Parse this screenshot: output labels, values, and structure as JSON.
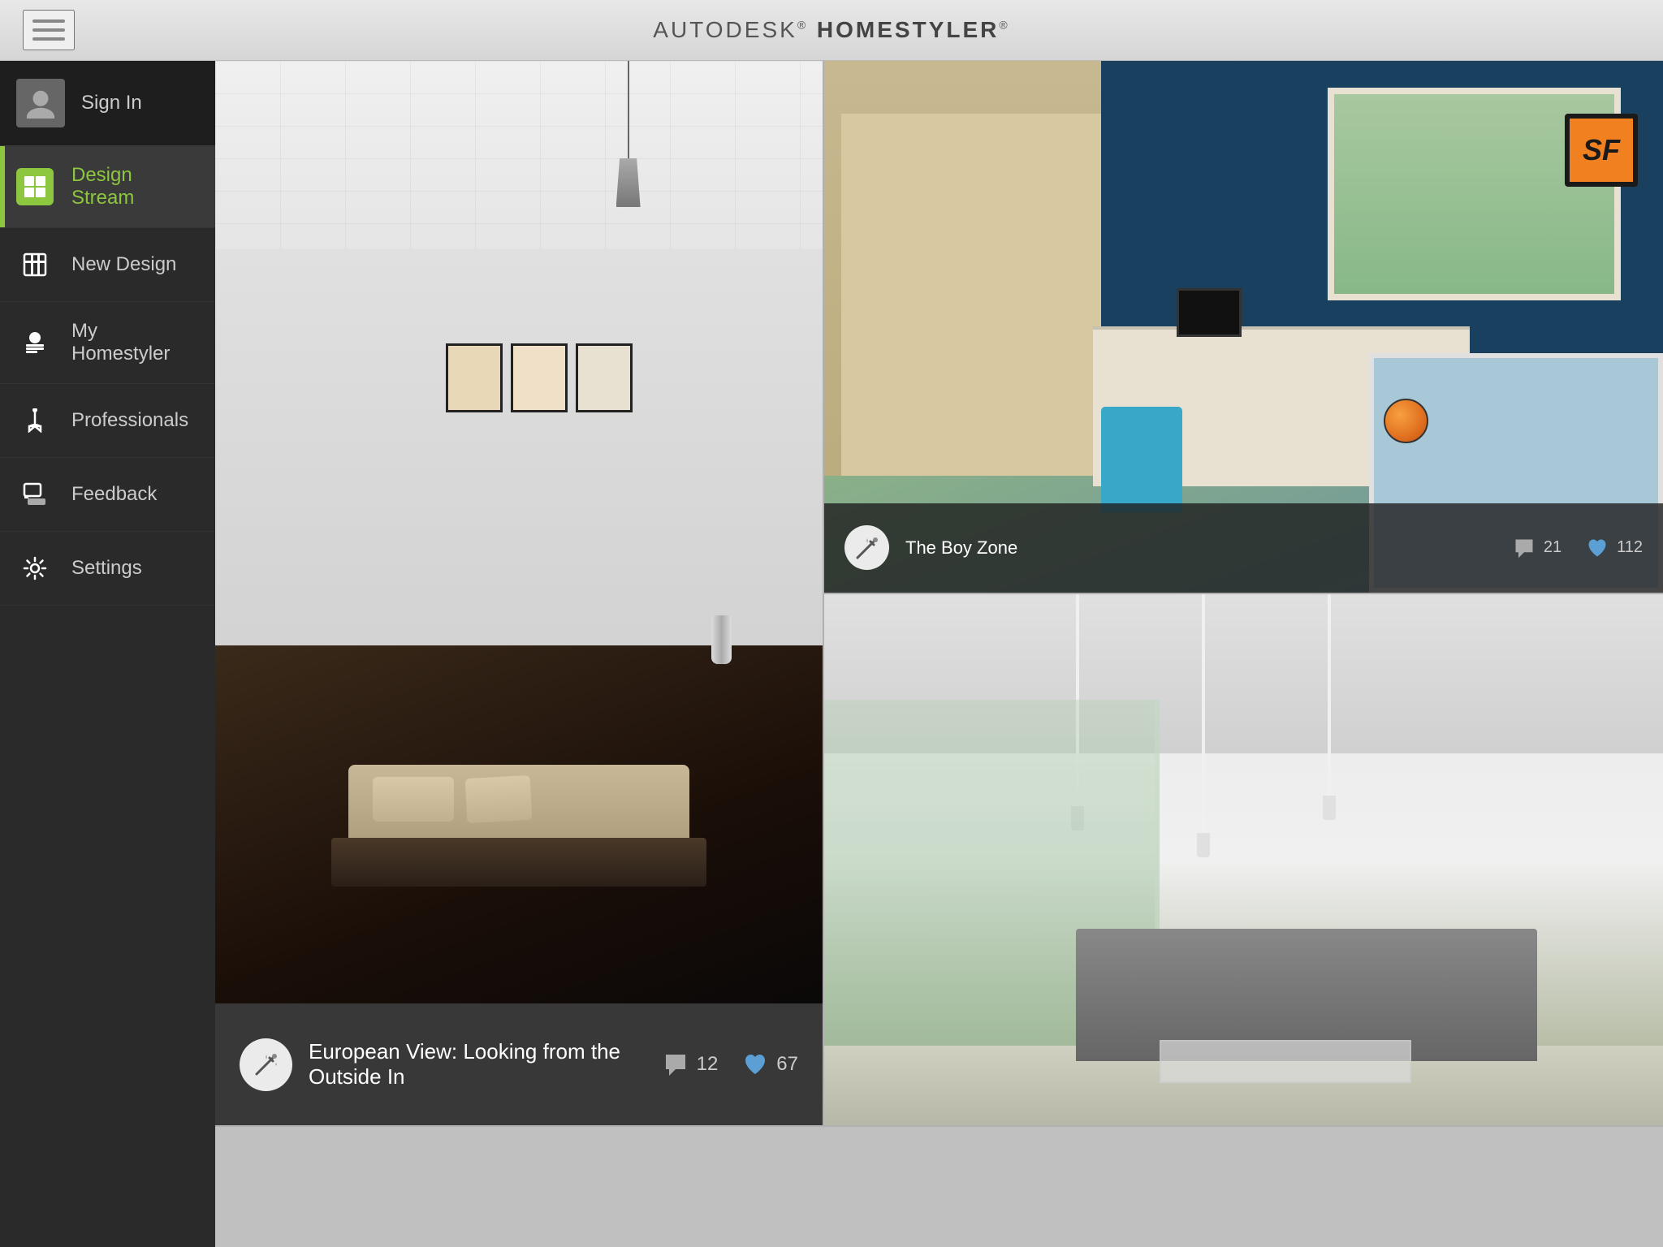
{
  "app": {
    "title_prefix": "AUTODESK",
    "title_main": "HOMESTYLER",
    "title_reg": "®"
  },
  "sidebar": {
    "sign_in_label": "Sign In",
    "items": [
      {
        "id": "design-stream",
        "label": "Design Stream",
        "active": true
      },
      {
        "id": "new-design",
        "label": "New Design",
        "active": false
      },
      {
        "id": "my-homestyler",
        "label": "My Homestyler",
        "active": false
      },
      {
        "id": "professionals",
        "label": "Professionals",
        "active": false
      },
      {
        "id": "feedback",
        "label": "Feedback",
        "active": false
      },
      {
        "id": "settings",
        "label": "Settings",
        "active": false
      }
    ]
  },
  "designs": {
    "main": {
      "title": "European View: Looking from the Outside In",
      "comments": 12,
      "likes": 67
    },
    "top_right": {
      "title": "The Boy Zone",
      "comments": 21,
      "likes": 112
    }
  }
}
